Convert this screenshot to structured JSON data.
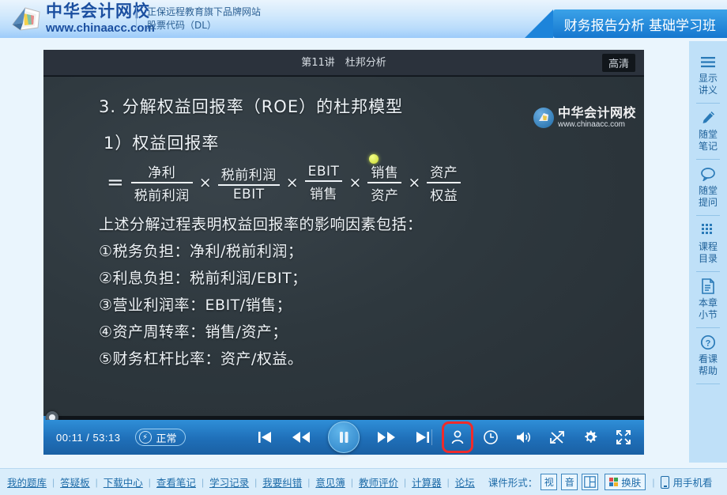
{
  "header": {
    "logo_cn": "中华会计网校",
    "logo_en": "www.chinaacc.com",
    "sub_line1": "正保远程教育旗下品牌网站",
    "sub_line2": "股票代码（DL）",
    "course_tab": "财务报告分析 基础学习班"
  },
  "player": {
    "title": "第11讲　杜邦分析",
    "quality_badge": "高清",
    "watermark_cn": "中华会计网校",
    "watermark_en": "www.chinaacc.com",
    "slide": {
      "heading1": "3. 分解权益回报率（ROE）的杜邦模型",
      "heading2": "1）权益回报率",
      "equals": "=",
      "times": "×",
      "fractions": [
        {
          "num": "净利",
          "den": "税前利润"
        },
        {
          "num": "税前利润",
          "den": "EBIT"
        },
        {
          "num": "EBIT",
          "den": "销售"
        },
        {
          "num": "销售",
          "den": "资产"
        },
        {
          "num": "资产",
          "den": "权益"
        }
      ],
      "note": "上述分解过程表明权益回报率的影响因素包括：",
      "bullets": [
        "①税务负担：净利/税前利润；",
        "②利息负担：税前利润/EBIT；",
        "③营业利润率：EBIT/销售；",
        "④资产周转率：销售/资产；",
        "⑤财务杠杆比率：资产/权益。"
      ]
    },
    "controls": {
      "time_current": "00:11",
      "time_separator": "/",
      "time_total": "53:13",
      "speed_label": "正常",
      "progress_percent": 0.35
    }
  },
  "sidebar": {
    "items": [
      {
        "icon": "menu-icon",
        "label_line1": "显示",
        "label_line2": "讲义"
      },
      {
        "icon": "pencil-icon",
        "label_line1": "随堂",
        "label_line2": "笔记"
      },
      {
        "icon": "chat-icon",
        "label_line1": "随堂",
        "label_line2": "提问"
      },
      {
        "icon": "grid-icon",
        "label_line1": "课程",
        "label_line2": "目录"
      },
      {
        "icon": "document-icon",
        "label_line1": "本章",
        "label_line2": "小节"
      },
      {
        "icon": "help-icon",
        "label_line1": "看课",
        "label_line2": "帮助"
      }
    ]
  },
  "bottombar": {
    "links": [
      "我的题库",
      "答疑板",
      "下载中心",
      "查看笔记",
      "学习记录",
      "我要纠错",
      "意见簿",
      "教师评价",
      "计算器",
      "论坛"
    ],
    "separator": "|",
    "format_label": "课件形式：",
    "format_buttons": [
      "视",
      "音"
    ],
    "split_button_name": "split-view",
    "skin_label": "换肤",
    "mobile_label": "用手机看"
  },
  "colors": {
    "accent": "#1d6ba8",
    "player_bar": "#2f8fd8",
    "highlight": "#ef2b2b",
    "slide_bg": "#2e383e"
  }
}
